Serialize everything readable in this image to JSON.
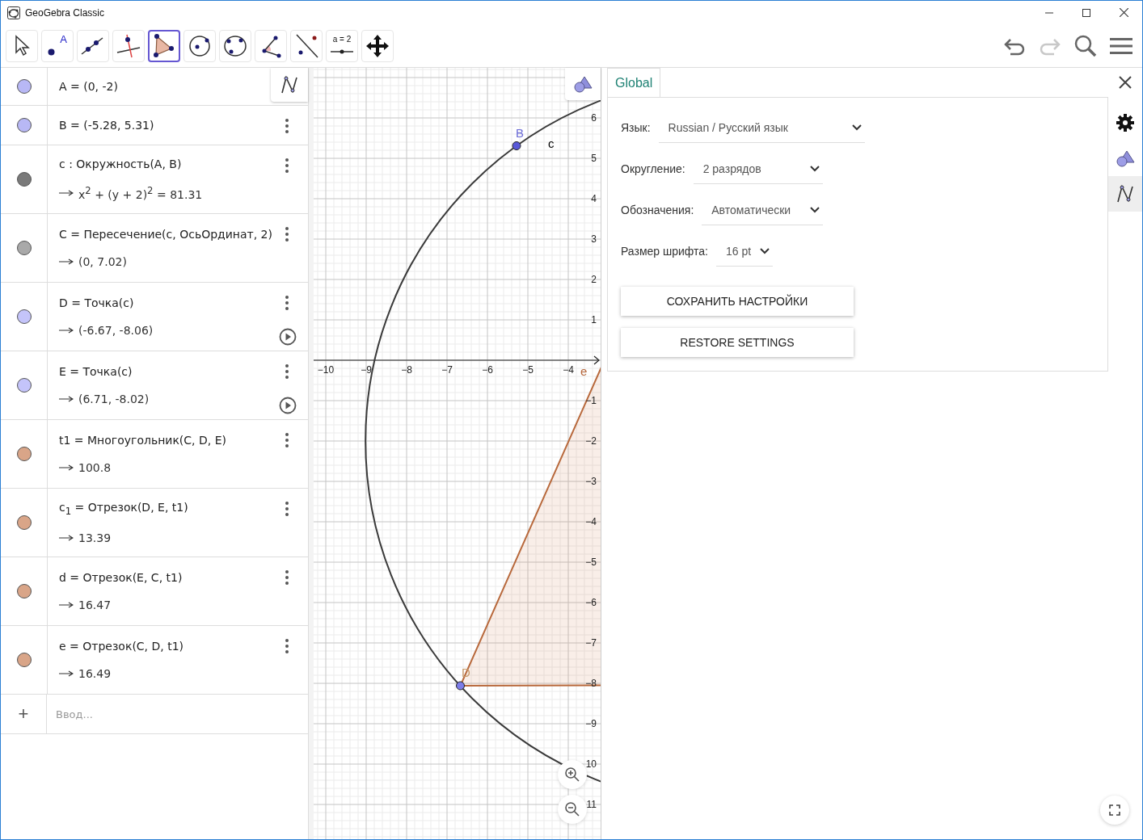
{
  "window": {
    "title": "GeoGebra Classic"
  },
  "toolbar": {
    "tools": [
      {
        "kind": "move",
        "selected": false
      },
      {
        "kind": "point",
        "label": "A",
        "selected": false
      },
      {
        "kind": "line",
        "selected": false
      },
      {
        "kind": "perpendicular",
        "selected": false
      },
      {
        "kind": "polygon",
        "selected": true
      },
      {
        "kind": "circle",
        "selected": false
      },
      {
        "kind": "circle3",
        "selected": false
      },
      {
        "kind": "angle",
        "selected": false
      },
      {
        "kind": "reflect",
        "selected": false
      },
      {
        "kind": "slider",
        "label": "a = 2",
        "selected": false
      },
      {
        "kind": "pan",
        "selected": false
      }
    ],
    "actions": [
      {
        "kind": "undo",
        "disabled": false
      },
      {
        "kind": "redo",
        "disabled": true
      },
      {
        "kind": "search",
        "disabled": false
      },
      {
        "kind": "menu",
        "disabled": false
      }
    ]
  },
  "algebra": {
    "items": [
      {
        "color": "#b8b8f5",
        "definition": "A = (0, -2)",
        "menu": false,
        "play_button": false
      },
      {
        "color": "#b8b8f5",
        "definition": "B = (-5.28, 5.31)",
        "menu": true,
        "play_button": false
      },
      {
        "color": "#7a7a7a",
        "definition": "c : Окружность(A, B)",
        "output": "x$^{2}$ + (y + 2)$^{2}$ = 81.31",
        "menu": true,
        "play_button": false
      },
      {
        "color": "#a9a9a9",
        "definition": "C = Пересечение(c, ОсьОрдинат, 2)",
        "output": "(0, 7.02)",
        "menu": true,
        "play_button": false
      },
      {
        "color": "#c4c4fa",
        "definition": "D = Точка(c)",
        "output": "(-6.67, -8.06)",
        "menu": true,
        "play_button": true
      },
      {
        "color": "#c4c4fa",
        "definition": "E = Точка(c)",
        "output": "(6.71, -8.02)",
        "menu": true,
        "play_button": true
      },
      {
        "color": "#d9a588",
        "definition": "t1 = Многоугольник(C, D, E)",
        "output": "100.8",
        "menu": true,
        "play_button": false
      },
      {
        "color": "#d9a588",
        "definition": "c$_{1}$ = Отрезок(D, E, t1)",
        "output": "13.39",
        "menu": true,
        "play_button": false
      },
      {
        "color": "#d9a588",
        "definition": "d = Отрезок(E, C, t1)",
        "output": "16.47",
        "menu": true,
        "play_button": false
      },
      {
        "color": "#d9a588",
        "definition": "e = Отрезок(C, D, t1)",
        "output": "16.49",
        "menu": true,
        "play_button": false
      }
    ],
    "input": {
      "add_label": "+",
      "placeholder": "Ввод..."
    }
  },
  "graphics": {
    "x_ticks": [
      "−10",
      "−9",
      "−8",
      "−7",
      "−6",
      "−5",
      "−4"
    ],
    "y_ticks": [
      "6",
      "5",
      "4",
      "3",
      "2",
      "1",
      "−1",
      "−2",
      "−3",
      "−4",
      "−5",
      "−6",
      "−7",
      "−8",
      "−9",
      "10",
      "11"
    ],
    "object_labels": [
      {
        "text": "B",
        "color": "#6b6bd6"
      },
      {
        "text": "c",
        "color": "#000000"
      },
      {
        "text": "D",
        "color": "#c89a6a"
      },
      {
        "text": "e",
        "color": "#b5653a"
      }
    ]
  },
  "settings": {
    "tabs": [
      {
        "label": "Global",
        "selected": true
      }
    ],
    "fields": [
      {
        "label": "Язык:",
        "value": "Russian / Русский язык"
      },
      {
        "label": "Округление:",
        "value": "2 разрядов"
      },
      {
        "label": "Обозначения:",
        "value": "Автоматически"
      },
      {
        "label": "Размер шрифта:",
        "value": "16 pt"
      }
    ],
    "buttons": [
      "СОХРАНИТЬ НАСТРОЙКИ",
      "RESTORE SETTINGS"
    ],
    "side_tabs": [
      {
        "kind": "general",
        "selected": false
      },
      {
        "kind": "graphics",
        "selected": false
      },
      {
        "kind": "algebra",
        "selected": true
      }
    ]
  }
}
